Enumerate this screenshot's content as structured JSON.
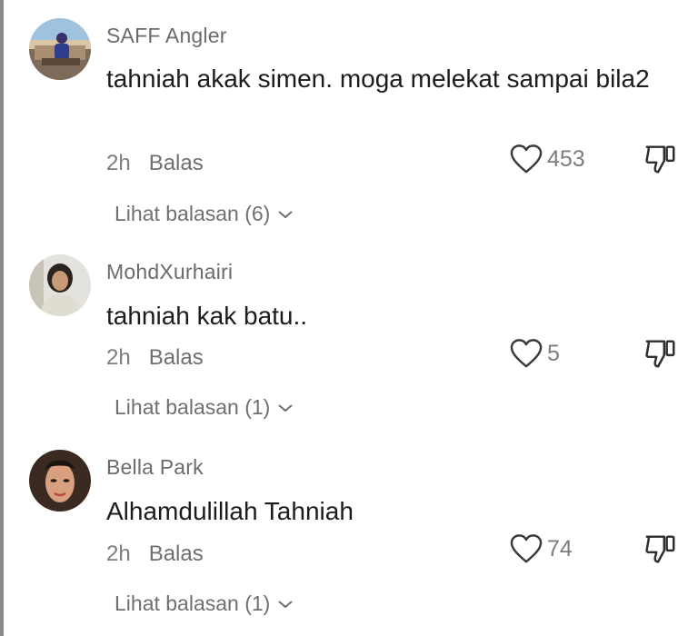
{
  "comments": [
    {
      "username": "SAFF Angler",
      "text": "tahniah akak simen. moga melekat sampai bila2",
      "time": "2h",
      "reply_label": "Balas",
      "likes": "453",
      "view_replies": "Lihat balasan (6)",
      "avatar_icon": "profile-photo"
    },
    {
      "username": "MohdXurhairi",
      "text": "tahniah kak batu..",
      "time": "2h",
      "reply_label": "Balas",
      "likes": "5",
      "view_replies": "Lihat balasan (1)",
      "avatar_icon": "profile-photo"
    },
    {
      "username": "Bella Park",
      "text": "Alhamdulillah Tahniah",
      "time": "2h",
      "reply_label": "Balas",
      "likes": "74",
      "view_replies": "Lihat balasan (1)",
      "avatar_icon": "profile-photo"
    }
  ],
  "icons": {
    "like": "heart-outline-icon",
    "dislike": "thumbs-down-outline-icon",
    "expand": "chevron-down-icon"
  },
  "colors": {
    "username": "#6b6b6b",
    "text": "#1c1c1c",
    "meta": "#7d7d7d"
  }
}
